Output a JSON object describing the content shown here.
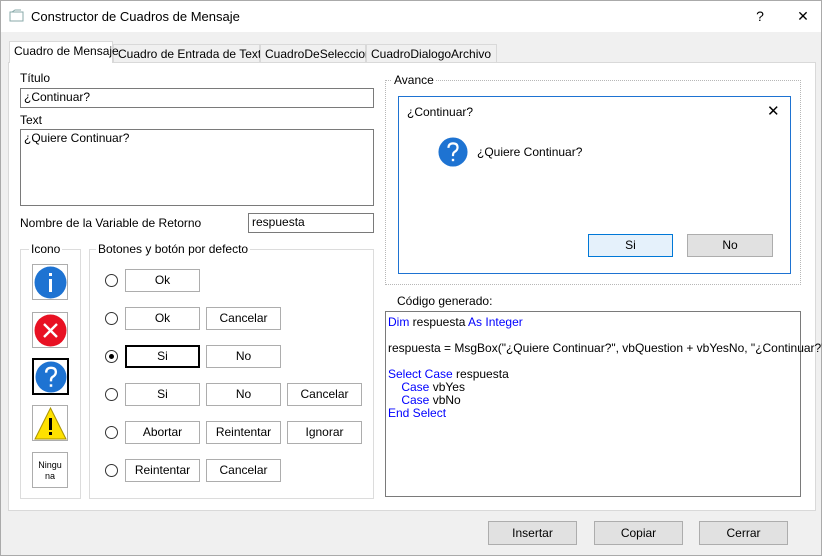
{
  "window": {
    "title": "Constructor de Cuadros de Mensaje",
    "help_label": "?",
    "close_label": "✕"
  },
  "tabs": [
    {
      "label": "Cuadro de Mensaje",
      "active": true
    },
    {
      "label": "Cuadro de Entrada de Texto",
      "active": false
    },
    {
      "label": "CuadroDeSeleccion",
      "active": false
    },
    {
      "label": "CuadroDialogoArchivo",
      "active": false
    }
  ],
  "form": {
    "title_label": "Título",
    "title_value": "¿Continuar?",
    "text_label": "Text",
    "text_value": "¿Quiere Continuar?",
    "return_var_label": "Nombre de la Variable de Retorno",
    "return_var_value": "respuesta"
  },
  "icon_group": {
    "title": "Icono",
    "items": [
      {
        "name": "information",
        "selected": false
      },
      {
        "name": "critical",
        "selected": false
      },
      {
        "name": "question",
        "selected": true
      },
      {
        "name": "exclamation",
        "selected": false
      },
      {
        "name": "none",
        "label": "Ningu\nna",
        "selected": false
      }
    ]
  },
  "buttons_group": {
    "title": "Botones y botón por defecto",
    "rows": [
      {
        "selected": false,
        "buttons": [
          "Ok"
        ]
      },
      {
        "selected": false,
        "buttons": [
          "Ok",
          "Cancelar"
        ]
      },
      {
        "selected": true,
        "buttons": [
          "Si",
          "No"
        ],
        "default_index": 0
      },
      {
        "selected": false,
        "buttons": [
          "Si",
          "No",
          "Cancelar"
        ]
      },
      {
        "selected": false,
        "buttons": [
          "Abortar",
          "Reintentar",
          "Ignorar"
        ]
      },
      {
        "selected": false,
        "buttons": [
          "Reintentar",
          "Cancelar"
        ]
      }
    ]
  },
  "preview": {
    "group_title": "Avance",
    "dialog_title": "¿Continuar?",
    "message": "¿Quiere Continuar?",
    "close_label": "✕",
    "yes_label": "Si",
    "no_label": "No"
  },
  "code": {
    "label": "Código generado:",
    "lines": [
      [
        {
          "t": "Dim",
          "kw": true
        },
        {
          "t": " respuesta ",
          "kw": false
        },
        {
          "t": "As Integer",
          "kw": true
        }
      ],
      [],
      [
        {
          "t": "respuesta = MsgBox(\"¿Quiere Continuar?\", vbQuestion + vbYesNo, \"¿Continuar?\")",
          "kw": false
        }
      ],
      [],
      [
        {
          "t": "Select Case",
          "kw": true
        },
        {
          "t": " respuesta",
          "kw": false
        }
      ],
      [
        {
          "t": "    ",
          "kw": false
        },
        {
          "t": "Case",
          "kw": true
        },
        {
          "t": " vbYes",
          "kw": false
        }
      ],
      [
        {
          "t": "    ",
          "kw": false
        },
        {
          "t": "Case",
          "kw": true
        },
        {
          "t": " vbNo",
          "kw": false
        }
      ],
      [
        {
          "t": "End Select",
          "kw": true
        }
      ]
    ]
  },
  "footer": {
    "insert_label": "Insertar",
    "copy_label": "Copiar",
    "close_label": "Cerrar"
  },
  "colors": {
    "info_blue": "#1e73d2",
    "critical_red": "#e81123",
    "warning_yellow": "#ffe100",
    "keyword_blue": "#0000ff"
  }
}
